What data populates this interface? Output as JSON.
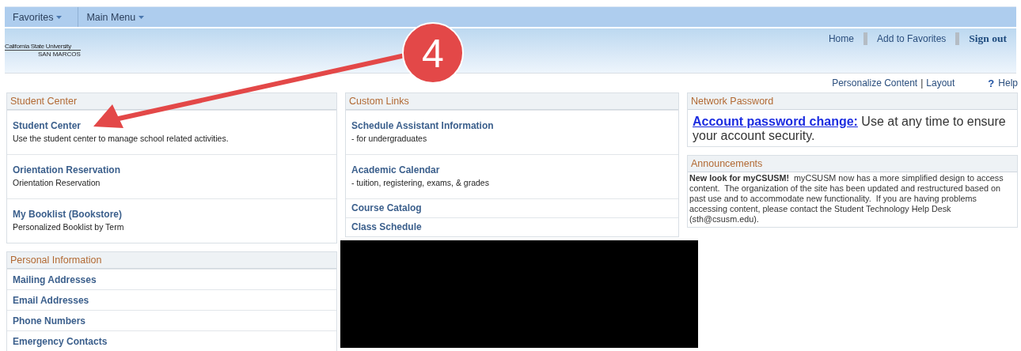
{
  "nav": {
    "menus": [
      {
        "label": "Favorites"
      },
      {
        "label": "Main Menu"
      }
    ]
  },
  "header": {
    "logo": {
      "line1": "California State University",
      "line2": "SAN MARCOS"
    },
    "links": [
      {
        "label": "Home",
        "kind": "link"
      },
      {
        "label": "Add to Favorites",
        "kind": "link"
      },
      {
        "label": "Sign out",
        "kind": "strong"
      }
    ]
  },
  "toolbar": {
    "personalize": "Personalize Content",
    "separator": "|",
    "layout": "Layout",
    "help_icon": "?",
    "help": "Help"
  },
  "callout": {
    "number": "4"
  },
  "columns": [
    [
      {
        "title": "Student Center",
        "kind": "described",
        "items": [
          {
            "link": "Student Center",
            "desc": "Use the student center to manage school related activities."
          },
          {
            "link": "Orientation Reservation",
            "desc": "Orientation Reservation"
          },
          {
            "link": "My Booklist (Bookstore)",
            "desc": "Personalized Booklist by Term"
          }
        ]
      },
      {
        "title": "Personal Information",
        "kind": "list",
        "items": [
          {
            "link": "Mailing Addresses"
          },
          {
            "link": "Email Addresses"
          },
          {
            "link": "Phone Numbers"
          },
          {
            "link": "Emergency Contacts"
          }
        ]
      }
    ],
    [
      {
        "title": "Custom Links",
        "kind": "described",
        "items": [
          {
            "link": "Schedule Assistant Information",
            "desc": "- for undergraduates"
          },
          {
            "link": "Academic Calendar",
            "desc": "- tuition, registering, exams, & grades"
          },
          {
            "link": "Course Catalog"
          },
          {
            "link": "Class Schedule"
          }
        ]
      },
      {
        "kind": "redacted"
      }
    ],
    [
      {
        "title": "Network Password",
        "kind": "password",
        "link": "Account password change:",
        "text": " Use at any time to ensure your account security."
      },
      {
        "title": "Announcements",
        "kind": "text",
        "text": "**New look for myCSUSM!**  myCSUSM now has a more simplified design to access content.  The organization of the site has been updated and restructured based on past use and to accommodate new functionality.  If you are having problems accessing content, please contact the Student Technology Help Desk (sth@csusm.edu)."
      }
    ]
  ]
}
